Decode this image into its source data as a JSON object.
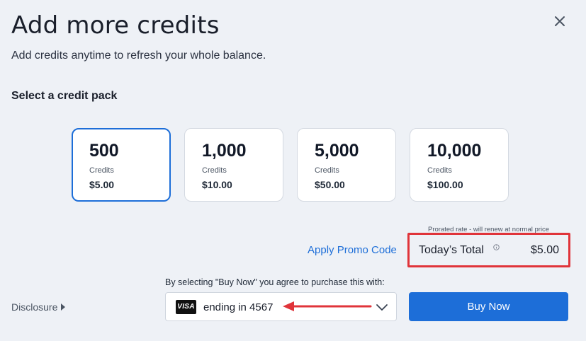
{
  "dialog": {
    "title": "Add more credits",
    "subtitle": "Add credits anytime to refresh your whole balance.",
    "section_title": "Select a credit pack"
  },
  "packs": [
    {
      "amount": "500",
      "unit": "Credits",
      "price": "$5.00",
      "selected": true
    },
    {
      "amount": "1,000",
      "unit": "Credits",
      "price": "$10.00",
      "selected": false
    },
    {
      "amount": "5,000",
      "unit": "Credits",
      "price": "$50.00",
      "selected": false
    },
    {
      "amount": "10,000",
      "unit": "Credits",
      "price": "$100.00",
      "selected": false
    }
  ],
  "summary": {
    "prorated_note": "Prorated rate - will renew at normal price",
    "promo_label": "Apply Promo Code",
    "total_label": "Today’s Total",
    "total_value": "$5.00"
  },
  "payment": {
    "agree_text": "By selecting \"Buy Now\" you agree to purchase this with:",
    "card_brand": "VISA",
    "card_text": "ending in 4567",
    "buy_label": "Buy Now",
    "disclosure_label": "Disclosure"
  },
  "colors": {
    "accent": "#1d6ed8",
    "highlight": "#e0343a"
  },
  "icons": {
    "close": "close-icon",
    "info": "info-icon",
    "chevron": "chevron-down-icon",
    "disclosure": "caret-right-icon"
  }
}
